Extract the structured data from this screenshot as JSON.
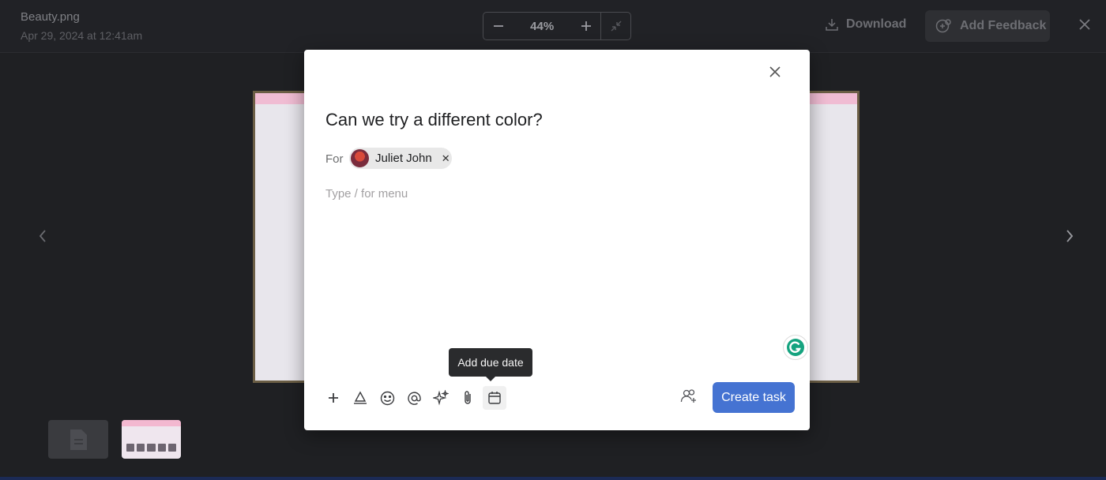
{
  "header": {
    "file_name": "Beauty.png",
    "file_date": "Apr 29, 2024 at 12:41am",
    "zoom_level": "44%",
    "download_label": "Download",
    "feedback_label": "Add Feedback"
  },
  "modal": {
    "task_title": "Can we try a different color?",
    "for_label": "For",
    "assignee_name": "Juliet John",
    "description_placeholder": "Type / for menu",
    "tooltip_text": "Add due date",
    "create_label": "Create task",
    "toolbar_icons": [
      "plus-icon",
      "text-format-icon",
      "emoji-icon",
      "mention-icon",
      "sparkle-icon",
      "attachment-icon",
      "calendar-icon"
    ]
  },
  "colors": {
    "accent": "#4573d2",
    "background": "#1f2023",
    "modal": "#ffffff",
    "tooltip": "#2a2b2d"
  }
}
